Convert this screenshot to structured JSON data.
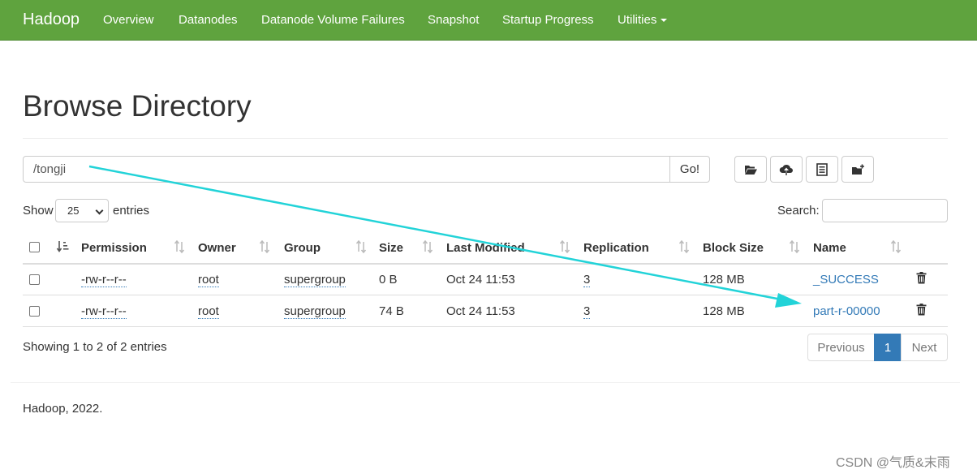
{
  "navbar": {
    "brand": "Hadoop",
    "items": [
      "Overview",
      "Datanodes",
      "Datanode Volume Failures",
      "Snapshot",
      "Startup Progress",
      "Utilities"
    ]
  },
  "page": {
    "title": "Browse Directory"
  },
  "path": {
    "value": "/tongji",
    "go_label": "Go!"
  },
  "toolbar": {
    "icons": [
      "folder-open-icon",
      "cloud-upload-icon",
      "list-alt-icon",
      "folder-new-icon"
    ]
  },
  "length_control": {
    "show_label": "Show",
    "selected": "25",
    "entries_label": "entries"
  },
  "search": {
    "label": "Search:"
  },
  "table": {
    "columns": [
      "Permission",
      "Owner",
      "Group",
      "Size",
      "Last Modified",
      "Replication",
      "Block Size",
      "Name"
    ],
    "rows": [
      {
        "permission": "-rw-r--r--",
        "owner": "root",
        "group": "supergroup",
        "size": "0 B",
        "last_modified": "Oct 24 11:53",
        "replication": "3",
        "block_size": "128 MB",
        "name": "_SUCCESS"
      },
      {
        "permission": "-rw-r--r--",
        "owner": "root",
        "group": "supergroup",
        "size": "74 B",
        "last_modified": "Oct 24 11:53",
        "replication": "3",
        "block_size": "128 MB",
        "name": "part-r-00000"
      }
    ]
  },
  "info": "Showing 1 to 2 of 2 entries",
  "pagination": {
    "previous": "Previous",
    "current": "1",
    "next": "Next"
  },
  "footer": "Hadoop, 2022.",
  "watermark": "CSDN @气质&末雨",
  "colors": {
    "navbar": "#5fa33e",
    "link": "#337ab7",
    "annotation_arrow": "#22d3d8"
  }
}
